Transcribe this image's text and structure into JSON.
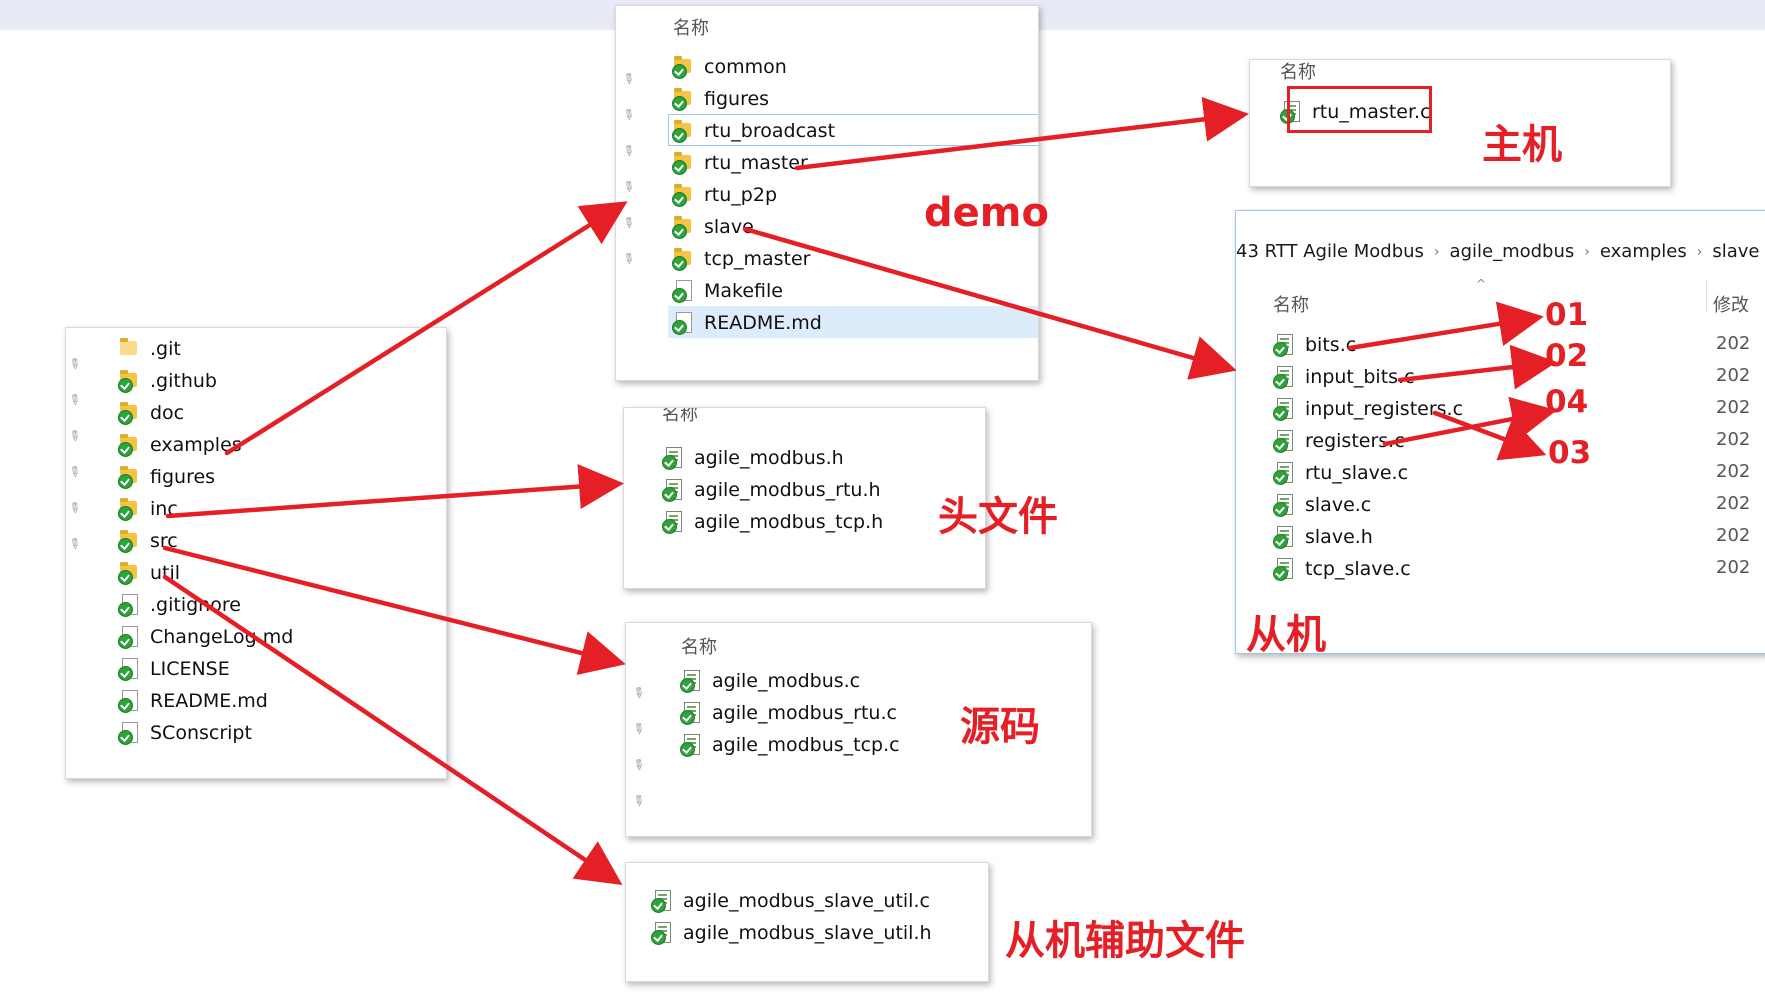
{
  "root_panel": {
    "items": [
      {
        "name": ".git",
        "icon": "folder-icon"
      },
      {
        "name": ".github",
        "icon": "folder-synced-icon"
      },
      {
        "name": "doc",
        "icon": "folder-synced-icon"
      },
      {
        "name": "examples",
        "icon": "folder-synced-icon"
      },
      {
        "name": "figures",
        "icon": "folder-synced-icon"
      },
      {
        "name": "inc",
        "icon": "folder-synced-icon"
      },
      {
        "name": "src",
        "icon": "folder-synced-icon"
      },
      {
        "name": "util",
        "icon": "folder-synced-icon"
      },
      {
        "name": ".gitignore",
        "icon": "file-synced-icon"
      },
      {
        "name": "ChangeLog.md",
        "icon": "file-synced-icon"
      },
      {
        "name": "LICENSE",
        "icon": "file-synced-icon"
      },
      {
        "name": "README.md",
        "icon": "file-synced-icon"
      },
      {
        "name": "SConscript",
        "icon": "file-synced-icon"
      }
    ]
  },
  "examples_panel": {
    "header": "名称",
    "items": [
      {
        "name": "common"
      },
      {
        "name": "figures"
      },
      {
        "name": "rtu_broadcast"
      },
      {
        "name": "rtu_master"
      },
      {
        "name": "rtu_p2p"
      },
      {
        "name": "slave"
      },
      {
        "name": "tcp_master"
      },
      {
        "name": "Makefile"
      },
      {
        "name": "README.md"
      }
    ]
  },
  "rtu_master_panel": {
    "header": "名称",
    "items": [
      {
        "name": "rtu_master.c"
      }
    ]
  },
  "slave_panel": {
    "breadcrumb": [
      "43 RTT Agile Modbus",
      "agile_modbus",
      "examples",
      "slave"
    ],
    "header": "名称",
    "header_right": "修改",
    "items": [
      {
        "name": "bits.c",
        "date": "202"
      },
      {
        "name": "input_bits.c",
        "date": "202"
      },
      {
        "name": "input_registers.c",
        "date": "202"
      },
      {
        "name": "registers.c",
        "date": "202"
      },
      {
        "name": "rtu_slave.c",
        "date": "202"
      },
      {
        "name": "slave.c",
        "date": "202"
      },
      {
        "name": "slave.h",
        "date": "202"
      },
      {
        "name": "tcp_slave.c",
        "date": "202"
      }
    ]
  },
  "inc_panel": {
    "header": "名称",
    "items": [
      {
        "name": "agile_modbus.h"
      },
      {
        "name": "agile_modbus_rtu.h"
      },
      {
        "name": "agile_modbus_tcp.h"
      }
    ]
  },
  "src_panel": {
    "header": "名称",
    "items": [
      {
        "name": "agile_modbus.c"
      },
      {
        "name": "agile_modbus_rtu.c"
      },
      {
        "name": "agile_modbus_tcp.c"
      }
    ]
  },
  "util_panel": {
    "items": [
      {
        "name": "agile_modbus_slave_util.c"
      },
      {
        "name": "agile_modbus_slave_util.h"
      }
    ]
  },
  "annotations": {
    "demo": "demo",
    "master": "主机",
    "headers": "头文件",
    "source": "源码",
    "slave": "从机",
    "slave_util": "从机辅助文件",
    "n01": "01",
    "n02": "02",
    "n04": "04",
    "n03": "03"
  },
  "colors": {
    "annotation_red": "#e41f26",
    "folder_yellow": "#f6c443",
    "sync_green": "#2ea33a",
    "selection_blue": "#dcecfb"
  }
}
